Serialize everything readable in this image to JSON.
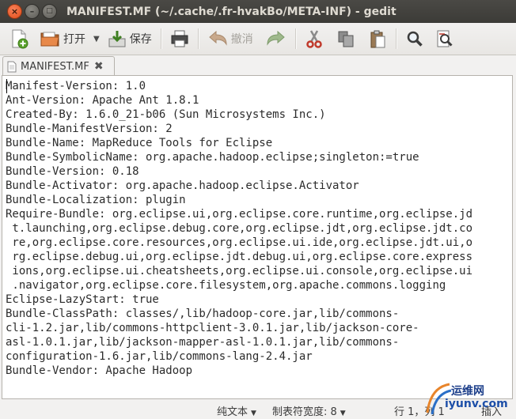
{
  "window": {
    "title": "MANIFEST.MF (~/.cache/.fr-hvakBo/META-INF) - gedit",
    "close_glyph": "×",
    "minimize_glyph": "–",
    "maximize_glyph": "□"
  },
  "toolbar": {
    "open_label": "打开",
    "save_label": "保存",
    "undo_label": "撤消"
  },
  "tab": {
    "label": "MANIFEST.MF",
    "close_glyph": "✖"
  },
  "editor": {
    "lines": [
      "Manifest-Version: 1.0",
      "Ant-Version: Apache Ant 1.8.1",
      "Created-By: 1.6.0_21-b06 (Sun Microsystems Inc.)",
      "Bundle-ManifestVersion: 2",
      "Bundle-Name: MapReduce Tools for Eclipse",
      "Bundle-SymbolicName: org.apache.hadoop.eclipse;singleton:=true",
      "Bundle-Version: 0.18",
      "Bundle-Activator: org.apache.hadoop.eclipse.Activator",
      "Bundle-Localization: plugin",
      "Require-Bundle: org.eclipse.ui,org.eclipse.core.runtime,org.eclipse.jd",
      " t.launching,org.eclipse.debug.core,org.eclipse.jdt,org.eclipse.jdt.co",
      " re,org.eclipse.core.resources,org.eclipse.ui.ide,org.eclipse.jdt.ui,o",
      " rg.eclipse.debug.ui,org.eclipse.jdt.debug.ui,org.eclipse.core.express",
      " ions,org.eclipse.ui.cheatsheets,org.eclipse.ui.console,org.eclipse.ui",
      " .navigator,org.eclipse.core.filesystem,org.apache.commons.logging",
      "Eclipse-LazyStart: true",
      "Bundle-ClassPath: classes/,lib/hadoop-core.jar,lib/commons-",
      "cli-1.2.jar,lib/commons-httpclient-3.0.1.jar,lib/jackson-core-",
      "asl-1.0.1.jar,lib/jackson-mapper-asl-1.0.1.jar,lib/commons-",
      "configuration-1.6.jar,lib/commons-lang-2.4.jar",
      "Bundle-Vendor: Apache Hadoop"
    ]
  },
  "statusbar": {
    "language": "纯文本",
    "tab_width": "制表符宽度: 8",
    "position": "行 1，列 1",
    "mode": "插入"
  },
  "watermark": {
    "line1": "运维网",
    "line2": "iyunv.com"
  }
}
